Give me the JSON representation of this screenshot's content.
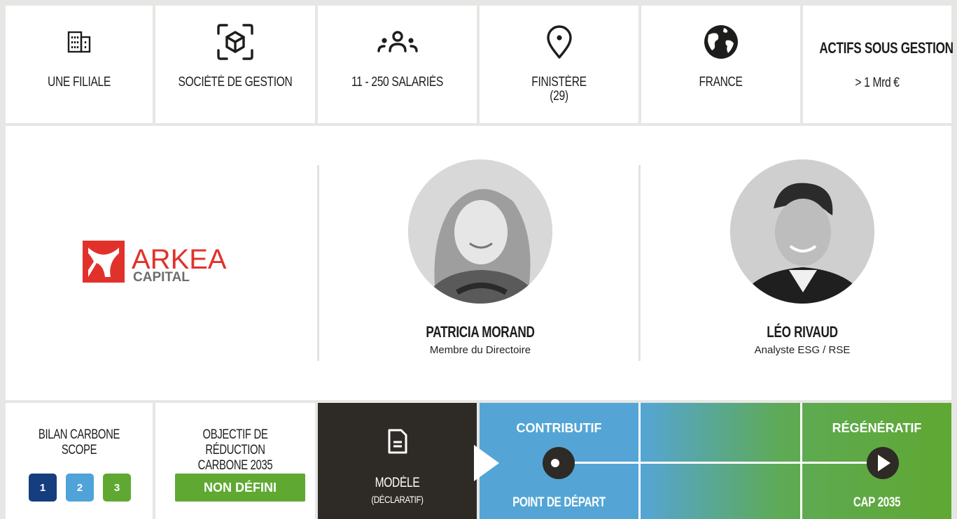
{
  "info_cells": [
    {
      "icon": "building-icon",
      "label": "UNE FILIALE"
    },
    {
      "icon": "cube-scan-icon",
      "label": "SOCIÉTÉ DE GESTION"
    },
    {
      "icon": "people-group-icon",
      "label": "11 - 250 SALARIÉS"
    },
    {
      "icon": "location-pin-icon",
      "label": "FINISTÈRE",
      "label2": "(29)"
    },
    {
      "icon": "globe-icon",
      "label": "FRANCE"
    }
  ],
  "aum": {
    "title": "ACTIFS SOUS GESTION",
    "value": "> 1 Mrd €"
  },
  "company": {
    "logo_main": "ARKEA",
    "logo_sub": "CAPITAL",
    "brand_color": "#e0322b"
  },
  "people": [
    {
      "name": "PATRICIA MORAND",
      "role": "Membre du Directoire",
      "avatar": "portrait-woman"
    },
    {
      "name": "LÉO RIVAUD",
      "role": "Analyste ESG / RSE",
      "avatar": "portrait-man"
    }
  ],
  "carbon": {
    "title_line1": "BILAN CARBONE",
    "title_line2": "SCOPE",
    "scopes": [
      {
        "label": "1",
        "color": "#163e7e"
      },
      {
        "label": "2",
        "color": "#4fa3d9"
      },
      {
        "label": "3",
        "color": "#5fa832"
      }
    ]
  },
  "objective": {
    "title_line1": "OBJECTIF DE RÉDUCTION",
    "title_line2": "CARBONE 2035",
    "status": "NON DÉFINI"
  },
  "model": {
    "label": "MODÈLE",
    "sublabel": "(DÉCLARATIF)"
  },
  "trajectory": {
    "start_head": "CONTRIBUTIF",
    "start_foot": "POINT DE DÉPART",
    "end_head": "RÉGÉNÉRATIF",
    "end_foot": "CAP 2035"
  },
  "colors": {
    "dark": "#2e2a26",
    "blue": "#54a5d6",
    "green": "#5fa832",
    "navy": "#163e7e"
  }
}
